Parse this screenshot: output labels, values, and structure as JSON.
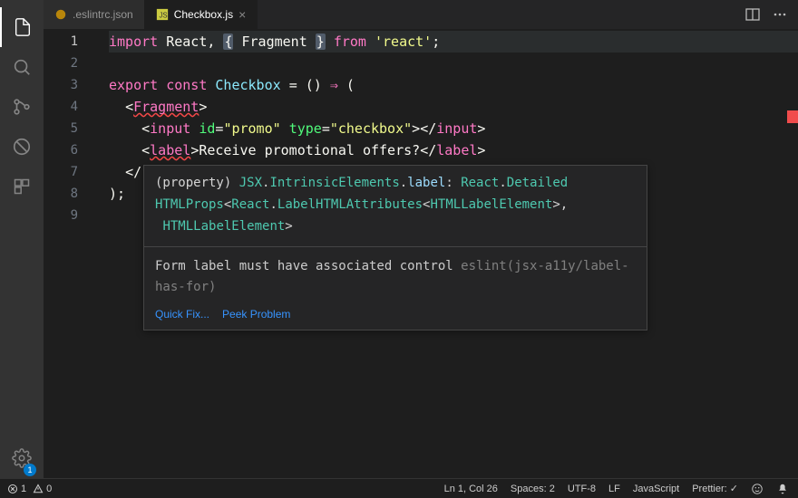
{
  "tabs": {
    "inactive": {
      "label": ".eslintrc.json"
    },
    "active": {
      "label": "Checkbox.js"
    }
  },
  "lines": [
    "1",
    "2",
    "3",
    "4",
    "5",
    "6",
    "7",
    "8",
    "9"
  ],
  "code": {
    "l1": {
      "import": "import",
      "react": "React",
      "comma": ",",
      "lb": "{",
      "frag": "Fragment",
      "rb": "}",
      "from": "from",
      "str": "'react'",
      "semi": ";"
    },
    "l3": {
      "export": "export",
      "const": "const",
      "name": "Checkbox",
      "eq": "=",
      "par": "()",
      "arrow": "⇒",
      "open": "("
    },
    "l4": {
      "lt": "<",
      "tag": "Fragment",
      "gt": ">"
    },
    "l5": {
      "lt": "<",
      "tag": "input",
      "a1": "id",
      "eq1": "=",
      "v1": "\"promo\"",
      "a2": "type",
      "eq2": "=",
      "v2": "\"checkbox\"",
      "gt": ">",
      "ct": "</",
      "ctag": "input",
      "cgt": ">"
    },
    "l6": {
      "lt": "<",
      "tag": "label",
      "gt": ">",
      "text": "Receive promotional offers?",
      "ct": "</",
      "ctag": "label",
      "cgt": ">"
    },
    "l7": {
      "ct": "</"
    },
    "l8": {
      "close": ");"
    }
  },
  "hover": {
    "sig_1": "(property) JSX.IntrinsicElements.label: React.Detailed",
    "sig_2a": "HTMLProps",
    "sig_2b": "React",
    "sig_2c": "LabelHTMLAttributes",
    "sig_2d": "HTMLLabelElement",
    "sig_3a": "HTMLLabelElement",
    "msg": "Form label must have associated control ",
    "rule": "eslint(jsx-a11y/label-has-for)",
    "quickfix": "Quick Fix...",
    "peek": "Peek Problem"
  },
  "status": {
    "errors": "1",
    "warnings": "0",
    "lncol": "Ln 1, Col 26",
    "spaces": "Spaces: 2",
    "encoding": "UTF-8",
    "eol": "LF",
    "lang": "JavaScript",
    "prettier": "Prettier: ✓"
  },
  "badge": "1"
}
